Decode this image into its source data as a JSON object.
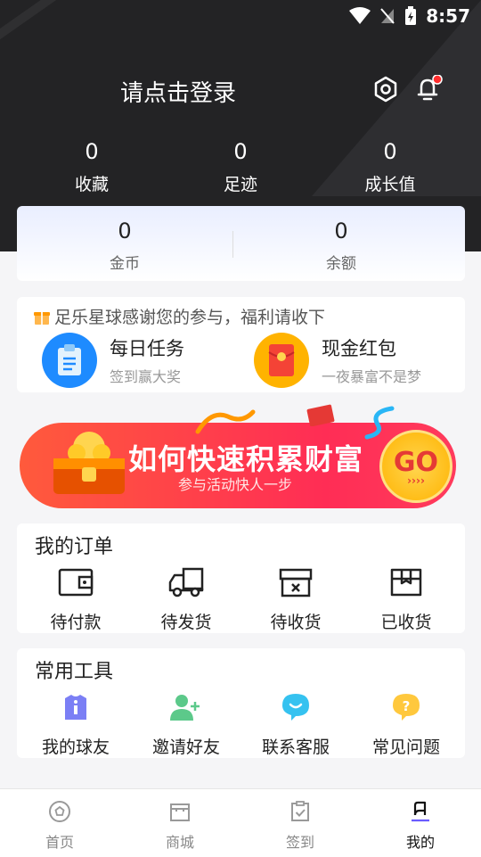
{
  "status": {
    "time": "8:57"
  },
  "header": {
    "login_text": "请点击登录",
    "settings_icon": "settings-hex-icon",
    "bell_icon": "bell-icon",
    "notification_dot_color": "#ff2d2d"
  },
  "stats": [
    {
      "value": "0",
      "label": "收藏"
    },
    {
      "value": "0",
      "label": "足迹"
    },
    {
      "value": "0",
      "label": "成长值"
    }
  ],
  "wallet": [
    {
      "value": "0",
      "label": "金币"
    },
    {
      "value": "0",
      "label": "余额"
    }
  ],
  "welfare": {
    "title": "足乐星球感谢您的参与，福利请收下",
    "tasks": [
      {
        "title": "每日任务",
        "subtitle": "签到赢大奖",
        "icon": "clipboard-icon",
        "color": "#1e8bff"
      },
      {
        "title": "现金红包",
        "subtitle": "一夜暴富不是梦",
        "icon": "red-packet-icon",
        "color": "#ffb300"
      }
    ]
  },
  "banner": {
    "title": "如何快速积累财富",
    "subtitle": "参与活动快人一步",
    "go_label": "GO",
    "go_arrows": "››››"
  },
  "orders": {
    "title": "我的订单",
    "items": [
      {
        "label": "待付款",
        "icon": "wallet-icon"
      },
      {
        "label": "待发货",
        "icon": "truck-icon"
      },
      {
        "label": "待收货",
        "icon": "box-x-icon"
      },
      {
        "label": "已收货",
        "icon": "package-icon"
      }
    ]
  },
  "tools": {
    "title": "常用工具",
    "items": [
      {
        "label": "我的球友",
        "icon": "jersey-icon",
        "color": "#7b7ff5"
      },
      {
        "label": "邀请好友",
        "icon": "add-user-icon",
        "color": "#5cc98a"
      },
      {
        "label": "联系客服",
        "icon": "chat-bubble-icon",
        "color": "#35c2f0"
      },
      {
        "label": "常见问题",
        "icon": "question-icon",
        "color": "#ffc83d"
      }
    ]
  },
  "tabbar": [
    {
      "label": "首页",
      "icon": "football-icon"
    },
    {
      "label": "商城",
      "icon": "shop-icon"
    },
    {
      "label": "签到",
      "icon": "checkin-icon"
    },
    {
      "label": "我的",
      "icon": "profile-icon",
      "active": true
    }
  ],
  "colors": {
    "header_bg": "#232325",
    "accent": "#ff2d55",
    "active_tab_underline": "#6b5cff"
  }
}
